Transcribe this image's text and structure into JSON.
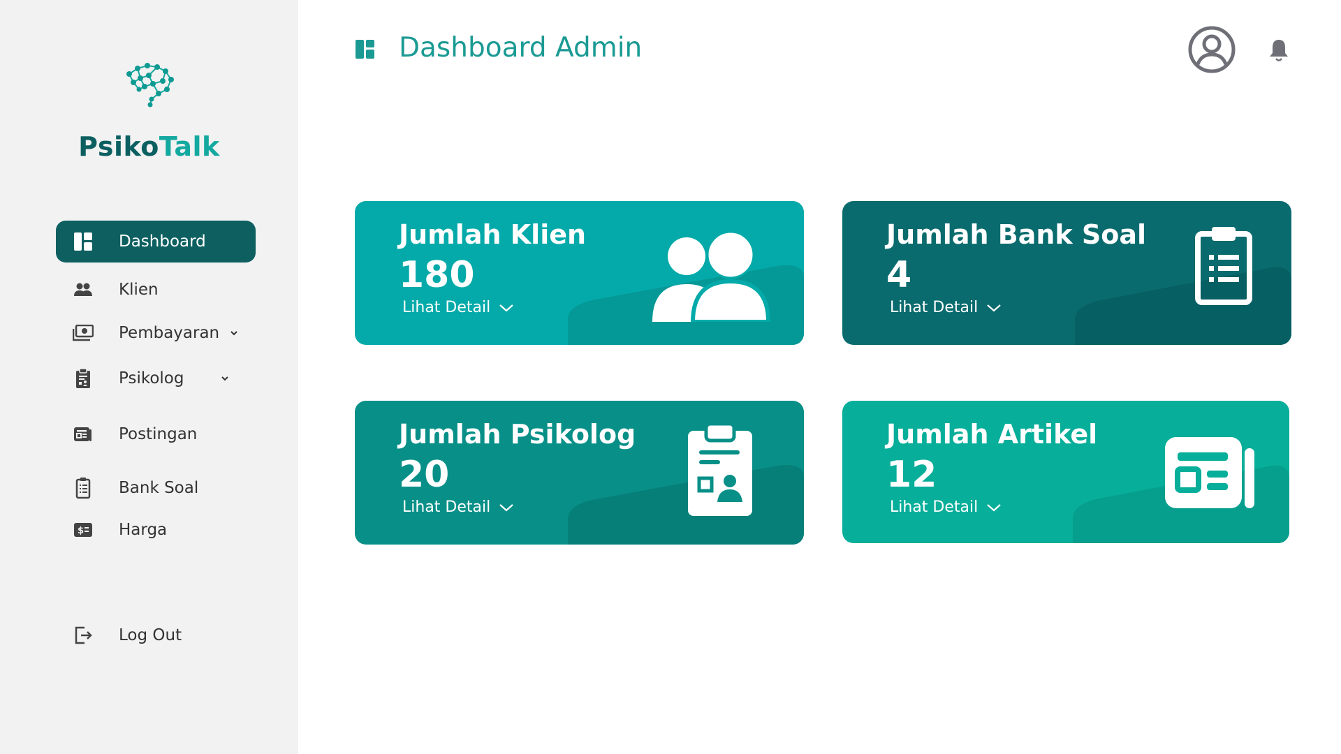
{
  "brand": {
    "name_part1": "Psiko",
    "name_part2": "Talk"
  },
  "header": {
    "title": "Dashboard Admin"
  },
  "sidebar": {
    "items": [
      {
        "label": "Dashboard",
        "icon": "dashboard-icon",
        "active": true
      },
      {
        "label": "Klien",
        "icon": "users-icon"
      },
      {
        "label": "Pembayaran",
        "icon": "money-icon",
        "has_submenu": true
      },
      {
        "label": "Psikolog",
        "icon": "clipboard-user-icon",
        "has_submenu": true
      },
      {
        "label": "Postingan",
        "icon": "newspaper-icon"
      },
      {
        "label": "Bank Soal",
        "icon": "clipboard-list-icon"
      },
      {
        "label": "Harga",
        "icon": "price-tag-icon"
      },
      {
        "label": "Log Out",
        "icon": "logout-icon"
      }
    ]
  },
  "cards": [
    {
      "title": "Jumlah Klien",
      "value": "180",
      "detail": "Lihat Detail",
      "icon": "users-icon",
      "color": "#04aaa9"
    },
    {
      "title": "Jumlah Bank Soal",
      "value": "4",
      "detail": "Lihat Detail",
      "icon": "clipboard-list-icon",
      "color": "#0a6b6e"
    },
    {
      "title": "Jumlah Psikolog",
      "value": "20",
      "detail": "Lihat Detail",
      "icon": "clipboard-user-icon",
      "color": "#089088"
    },
    {
      "title": "Jumlah Artikel",
      "value": "12",
      "detail": "Lihat Detail",
      "icon": "newspaper-icon",
      "color": "#07ae9a"
    }
  ],
  "colors": {
    "sidebar_bg": "#f2f2f2",
    "active_nav": "#0d5f60",
    "title_teal": "#1a9a93"
  }
}
